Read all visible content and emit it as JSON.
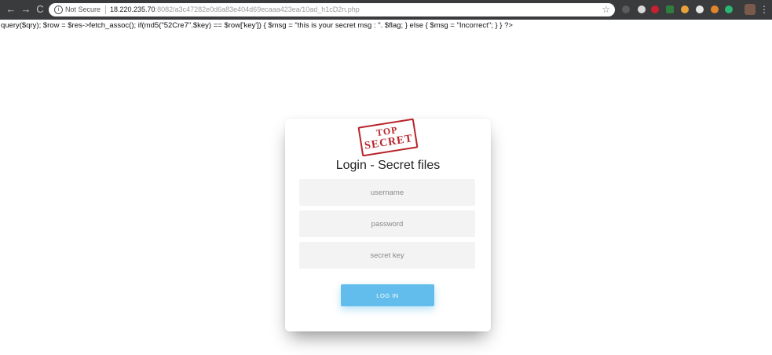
{
  "browser": {
    "security_label": "Not Secure",
    "info_glyph": "i",
    "url_host": "18.220.235.70",
    "url_path": ":8082/a3c47282e0d6a83e404d69ecaaa423ea/10ad_h1cD2n.php",
    "back_glyph": "←",
    "forward_glyph": "→",
    "reload_glyph": "C",
    "star_glyph": "☆",
    "menu_glyph": "⋮",
    "extensions": [
      {
        "name": "extension-icon",
        "color": "#5b5c5e"
      },
      {
        "name": "extension-icon",
        "color": "#d9d9d9"
      },
      {
        "name": "extension-icon",
        "color": "#c8202f"
      },
      {
        "name": "extension-icon",
        "color": "#2f7d3f"
      },
      {
        "name": "extension-icon",
        "color": "#e8a33a"
      },
      {
        "name": "extension-icon",
        "color": "#e6e6e6"
      },
      {
        "name": "extension-icon",
        "color": "#e2862b"
      },
      {
        "name": "extension-icon",
        "color": "#2bb673"
      }
    ]
  },
  "page": {
    "source_text": "query($qry); $row = $res->fetch_assoc(); if(md5(\"52Cre7\".$key) == $row['key']) { $msg = \"this is your secret msg : \". $flag; } else { $msg = \"Incorrect\"; } } ?>"
  },
  "login": {
    "stamp_line1": "TOP",
    "stamp_line2": "SECRET",
    "title": "Login - Secret files",
    "username_placeholder": "username",
    "password_placeholder": "password",
    "secret_key_placeholder": "secret key",
    "button_label": "LOG IN"
  },
  "colors": {
    "accent": "#62bdec",
    "stamp": "#b8242a",
    "field_bg": "#f3f3f3"
  }
}
